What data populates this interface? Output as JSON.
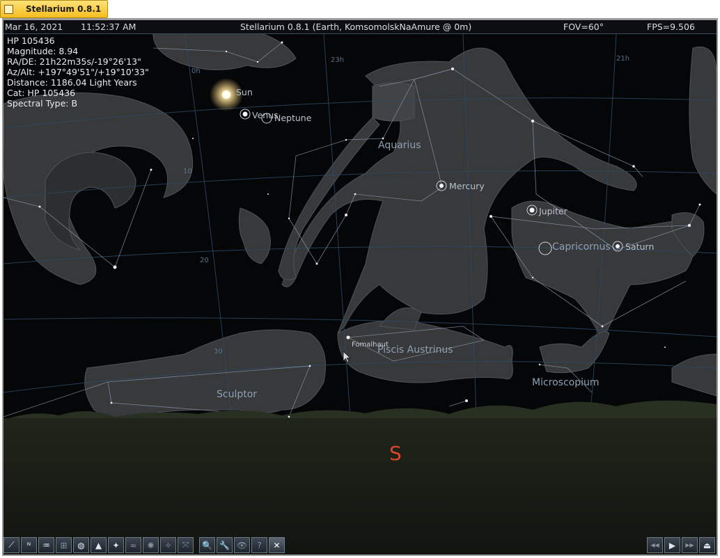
{
  "window": {
    "tab_title": "Stellarium 0.8.1"
  },
  "topbar": {
    "date": "Mar 16, 2021",
    "time": "11:52:37 AM",
    "title": "Stellarium 0.8.1 (Earth, KomsomolskNaAmure @ 0m)",
    "fov": "FOV=60°",
    "fps": "FPS=9.506"
  },
  "info": [
    "HP 105436",
    "Magnitude: 8.94",
    "RA/DE: 21h22m35s/-19°26'13\"",
    "Az/Alt: +197°49'51\"/+19°10'33\"",
    "Distance: 1186.04 Light Years",
    "Cat: HP 105436",
    "Spectral Type: B"
  ],
  "constellations": [
    "Aquarius",
    "Capricornus",
    "Piscis Austrinus",
    "Microscopium",
    "Sculptor"
  ],
  "planets": [
    "Sun",
    "Venus",
    "Neptune",
    "Mercury",
    "Jupiter",
    "Saturn"
  ],
  "stars": [
    "Fomalhaut"
  ],
  "grid_labels": [
    "0h",
    "23h",
    "21h",
    "10",
    "20",
    "30"
  ],
  "cardinal": "S",
  "toolbar": {
    "buttons": [
      {
        "name": "constellation-lines-button",
        "icon": "⟋"
      },
      {
        "name": "constellation-names-button",
        "icon": "ᴺ"
      },
      {
        "name": "constellation-art-button",
        "icon": "♒"
      },
      {
        "name": "azimuthal-grid-button",
        "icon": "⊞"
      },
      {
        "name": "equatorial-grid-button",
        "icon": "◍"
      },
      {
        "name": "ground-button",
        "icon": "▲"
      },
      {
        "name": "cardinal-points-button",
        "icon": "✦"
      },
      {
        "name": "atmosphere-button",
        "icon": "≈"
      },
      {
        "name": "nebulae-button",
        "icon": "✺"
      },
      {
        "name": "planet-hints-button",
        "icon": "✧"
      },
      {
        "name": "telescope-view-button",
        "icon": "⤧"
      },
      {
        "name": "search-button",
        "icon": "🔍"
      },
      {
        "name": "configuration-button",
        "icon": "🔧"
      },
      {
        "name": "night-mode-button",
        "icon": "👁"
      },
      {
        "name": "help-button",
        "icon": "?"
      },
      {
        "name": "quit-button",
        "icon": "✕"
      }
    ],
    "time_buttons": [
      {
        "name": "decrease-time-speed-button",
        "icon": "◀◀"
      },
      {
        "name": "real-time-speed-button",
        "icon": "▶"
      },
      {
        "name": "increase-time-speed-button",
        "icon": "▶▶"
      },
      {
        "name": "return-to-now-button",
        "icon": "⏏"
      }
    ]
  },
  "colors": {
    "sky": "#050608",
    "grid": "#2f4a66",
    "constellation_line": "#8a9bb0",
    "art": "#3f4143",
    "ground": "#1a1d14",
    "cardinal": "#d9472a"
  }
}
